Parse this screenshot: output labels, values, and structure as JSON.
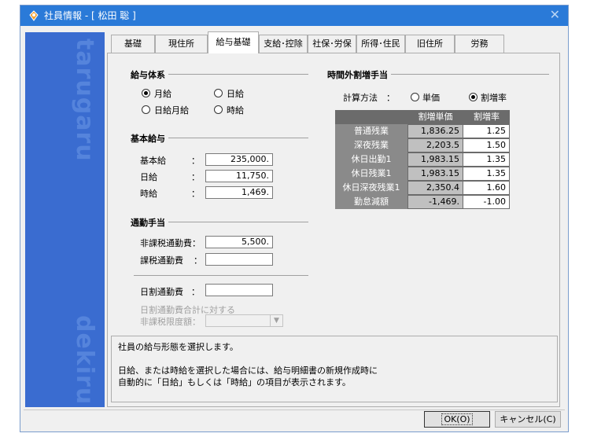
{
  "window": {
    "title": "社員情報 - [ 松田 聡 ]"
  },
  "sidebar": {
    "watermark_top": "tarugaru",
    "watermark_bottom": "dekiru"
  },
  "tabs": [
    {
      "label": "基礎"
    },
    {
      "label": "現住所"
    },
    {
      "label": "給与基礎",
      "active": true
    },
    {
      "label": "支給･控除"
    },
    {
      "label": "社保･労保"
    },
    {
      "label": "所得･住民"
    },
    {
      "label": "旧住所"
    },
    {
      "label": "労務"
    }
  ],
  "salary_system": {
    "title": "給与体系",
    "options": [
      {
        "label": "月給",
        "selected": true
      },
      {
        "label": "日給",
        "selected": false
      },
      {
        "label": "日給月給",
        "selected": false
      },
      {
        "label": "時給",
        "selected": false
      }
    ]
  },
  "base_salary": {
    "title": "基本給与",
    "colon": "：",
    "rows": [
      {
        "label": "基本給",
        "value": "235,000."
      },
      {
        "label": "日給",
        "value": "11,750."
      },
      {
        "label": "時給",
        "value": "1,469."
      }
    ]
  },
  "commute": {
    "title": "通勤手当",
    "nontaxable_label": "非課税通勤費：",
    "nontaxable_value": "5,500.",
    "taxable_label": "課税通勤費",
    "taxable_colon": "：",
    "taxable_value": "",
    "daily_label": "日割通勤費",
    "daily_colon": "：",
    "daily_value": "",
    "limit_label_line1": "日割通勤費合計に対する",
    "limit_label_line2": "非課税限度額：",
    "limit_value": ""
  },
  "overtime": {
    "title": "時間外割増手当",
    "calc_label": "計算方法　：",
    "methods": [
      {
        "label": "単価",
        "selected": false
      },
      {
        "label": "割増率",
        "selected": true
      }
    ],
    "headers": [
      "割増単価",
      "割増率"
    ],
    "rows": [
      {
        "label": "普通残業",
        "price": "1,836.25",
        "rate": "1.25"
      },
      {
        "label": "深夜残業",
        "price": "2,203.5",
        "rate": "1.50"
      },
      {
        "label": "休日出勤1",
        "price": "1,983.15",
        "rate": "1.35"
      },
      {
        "label": "休日残業1",
        "price": "1,983.15",
        "rate": "1.35"
      },
      {
        "label": "休日深夜残業1",
        "price": "2,350.4",
        "rate": "1.60"
      },
      {
        "label": "勤怠減額",
        "price": "-1,469.",
        "rate": "-1.00"
      }
    ]
  },
  "description": {
    "lines": [
      "社員の給与形態を選択します。",
      "",
      "日給、または時給を選択した場合には、給与明細書の新規作成時に",
      "自動的に「日給」もしくは「時給」の項目が表示されます。"
    ]
  },
  "buttons": {
    "ok": "OK(O)",
    "cancel": "キャンセル(C)"
  },
  "colors": {
    "titlebar": "#2a7ad8",
    "sidebar": "#3a6cd0",
    "table_header": "#6b6b6b"
  }
}
